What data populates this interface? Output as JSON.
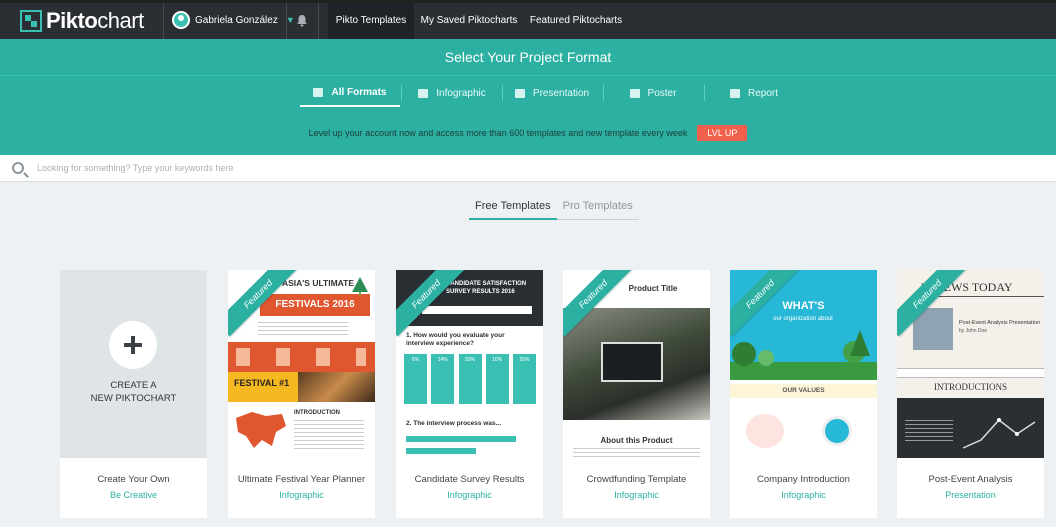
{
  "topnav": {
    "logo": {
      "pre": "Pikto",
      "post": "chart"
    },
    "user_name": "Gabriela González",
    "tabs": [
      "Pikto Templates",
      "My Saved Piktocharts",
      "Featured Piktocharts"
    ]
  },
  "header": {
    "title": "Select Your Project Format",
    "formats": [
      "All Formats",
      "Infographic",
      "Presentation",
      "Poster",
      "Report"
    ],
    "promo_text": "Level up your account now and access more than 600 templates and new template every week",
    "promo_button": "LVL UP"
  },
  "search": {
    "placeholder": "Looking for something? Type your keywords here"
  },
  "template_tabs": [
    "Free Templates",
    "Pro Templates"
  ],
  "create": {
    "line1": "CREATE A",
    "line2": "NEW PIKTOCHART",
    "title": "Create Your Own",
    "sub": "Be Creative"
  },
  "ribbon_label": "Featured",
  "cards": [
    {
      "title": "Ultimate Festival Year Planner",
      "sub": "Infographic",
      "t1": "ASIA'S ULTIMATE",
      "t2": "FESTIVALS 2016",
      "t3": "FESTIVAL #1",
      "t4": "INTRODUCTION"
    },
    {
      "title": "Candidate Survey Results",
      "sub": "Infographic",
      "t1": "CANDIDATE SATISFACTION SURVEY RESULTS 2016",
      "t2": "1. How would you evaluate your interview experience?",
      "t3": "2. The interview process was...",
      "pcts": [
        "6%",
        "14%",
        "50%",
        "10%",
        "20%"
      ]
    },
    {
      "title": "Crowdfunding Template",
      "sub": "Infographic",
      "t1": "Product Title",
      "t2": "About this Product"
    },
    {
      "title": "Company Introduction",
      "sub": "Infographic",
      "t1": "WHAT'S",
      "t2": "our organization about",
      "t3": "OUR VALUES"
    },
    {
      "title": "Post-Event Analysis",
      "sub": "Presentation",
      "t1": "W NEWS TODAY",
      "t2": "Post-Event Analysis Presentation",
      "t3": "by John Doe",
      "t4": "INTRODUCTIONS"
    }
  ],
  "colors": {
    "accent": "#2bb0a2",
    "nav": "#2b2f33",
    "promo": "#f0604d"
  }
}
